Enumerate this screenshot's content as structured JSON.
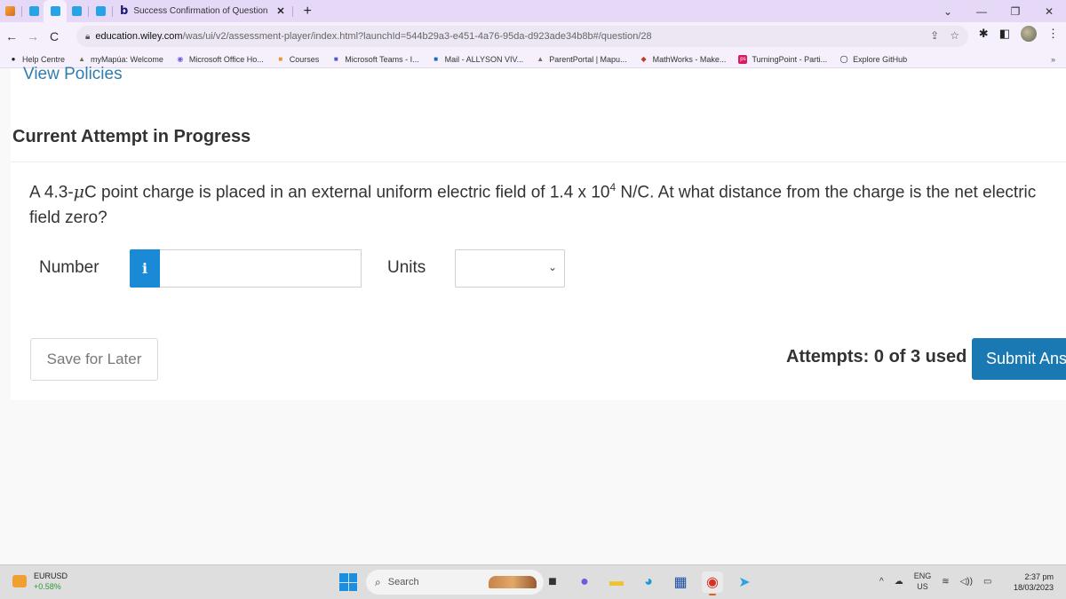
{
  "browser": {
    "tabs": [
      {
        "favicon": "orange-app-icon",
        "active": false
      },
      {
        "favicon": "wp-icon",
        "active": false
      },
      {
        "favicon": "wp-icon",
        "active": true
      },
      {
        "favicon": "wp-icon",
        "active": false
      },
      {
        "favicon": "wp-icon",
        "active": false
      }
    ],
    "main_tab": {
      "favicon": "b",
      "title": "Success Confirmation of Question",
      "close": "✕"
    },
    "new_tab": "+",
    "window_controls": {
      "dropdown": "⌄",
      "minimize": "—",
      "maximize": "❐",
      "close": "✕"
    },
    "nav": {
      "back": "←",
      "forward": "→",
      "reload": "C"
    },
    "url": {
      "domain": "education.wiley.com",
      "path": "/was/ui/v2/assessment-player/index.html?launchId=544b29a3-e451-4a76-95da-d923ade34b8b#/question/28"
    },
    "omnibox_icons": {
      "share": "⇪",
      "bookmark": "☆"
    },
    "toolbar_icons": {
      "extensions": "✱",
      "side_panel": "◧",
      "menu": "⋮"
    },
    "bookmarks": [
      {
        "icon": "globe-icon",
        "glyph": "●",
        "color": "#222222",
        "label": "Help Centre"
      },
      {
        "icon": "mapua-icon",
        "glyph": "▲",
        "color": "#7a6a50",
        "label": "myMapúa: Welcome"
      },
      {
        "icon": "office-icon",
        "glyph": "◉",
        "color": "#6a5ce0",
        "label": "Microsoft Office Ho..."
      },
      {
        "icon": "courses-icon",
        "glyph": "■",
        "color": "#e8952e",
        "label": "Courses"
      },
      {
        "icon": "teams-icon",
        "glyph": "■",
        "color": "#5059c9",
        "label": "Microsoft Teams - I..."
      },
      {
        "icon": "outlook-icon",
        "glyph": "■",
        "color": "#0f6cbd",
        "label": "Mail - ALLYSON VIV..."
      },
      {
        "icon": "mapua-icon",
        "glyph": "▲",
        "color": "#7a6a50",
        "label": "ParentPortal | Mapu..."
      },
      {
        "icon": "mathworks-icon",
        "glyph": "◆",
        "color": "#c0392b",
        "label": "MathWorks - Make..."
      },
      {
        "icon": "turningpoint-icon",
        "glyph": "ps",
        "color": "#d81b60",
        "label": "TurningPoint - Parti..."
      },
      {
        "icon": "github-icon",
        "glyph": "◯",
        "color": "#111111",
        "label": "Explore GitHub"
      }
    ],
    "bookmarks_more": "»"
  },
  "page": {
    "view_policies": "View Policies",
    "attempt_title": "Current Attempt in Progress",
    "question": {
      "part1": "A 4.3-",
      "mu": "μ",
      "part2": "C point charge is placed in an external uniform electric field of 1.4 x 10",
      "exponent": "4",
      "part3": " N/C. At what distance from the charge is the net electric field zero?"
    },
    "answer": {
      "number_label": "Number",
      "info_glyph": "i",
      "number_value": "",
      "number_placeholder": "",
      "units_label": "Units",
      "units_selected": "",
      "units_chevron": "⌄"
    },
    "save_label": "Save for Later",
    "attempts_text": "Attempts: 0 of 3 used",
    "submit_label": "Submit Answer"
  },
  "taskbar": {
    "widget": {
      "symbol": "EURUSD",
      "change": "+0.58%"
    },
    "search_label": "Search",
    "search_icon": "🔍",
    "apps": [
      {
        "name": "task-view-icon",
        "glyph": "■",
        "color": "#333333"
      },
      {
        "name": "teams-chat-icon",
        "glyph": "●",
        "color": "#6b5ce0"
      },
      {
        "name": "file-explorer-icon",
        "glyph": "▬",
        "color": "#f2c12e"
      },
      {
        "name": "edge-icon",
        "glyph": "◕",
        "color": "#1a9ad6"
      },
      {
        "name": "store-icon",
        "glyph": "▦",
        "color": "#1b4ea8"
      },
      {
        "name": "chrome-icon",
        "glyph": "◉",
        "color": "#d93025",
        "active": true
      },
      {
        "name": "telegram-icon",
        "glyph": "➤",
        "color": "#2aa3e0"
      }
    ],
    "tray": {
      "chevron": "^",
      "cloud": "☁",
      "lang_top": "ENG",
      "lang_bottom": "US",
      "wifi": "ᯤ",
      "volume": "🔊",
      "battery": "▭"
    },
    "clock": {
      "time": "2:37 pm",
      "date": "18/03/2023"
    }
  }
}
